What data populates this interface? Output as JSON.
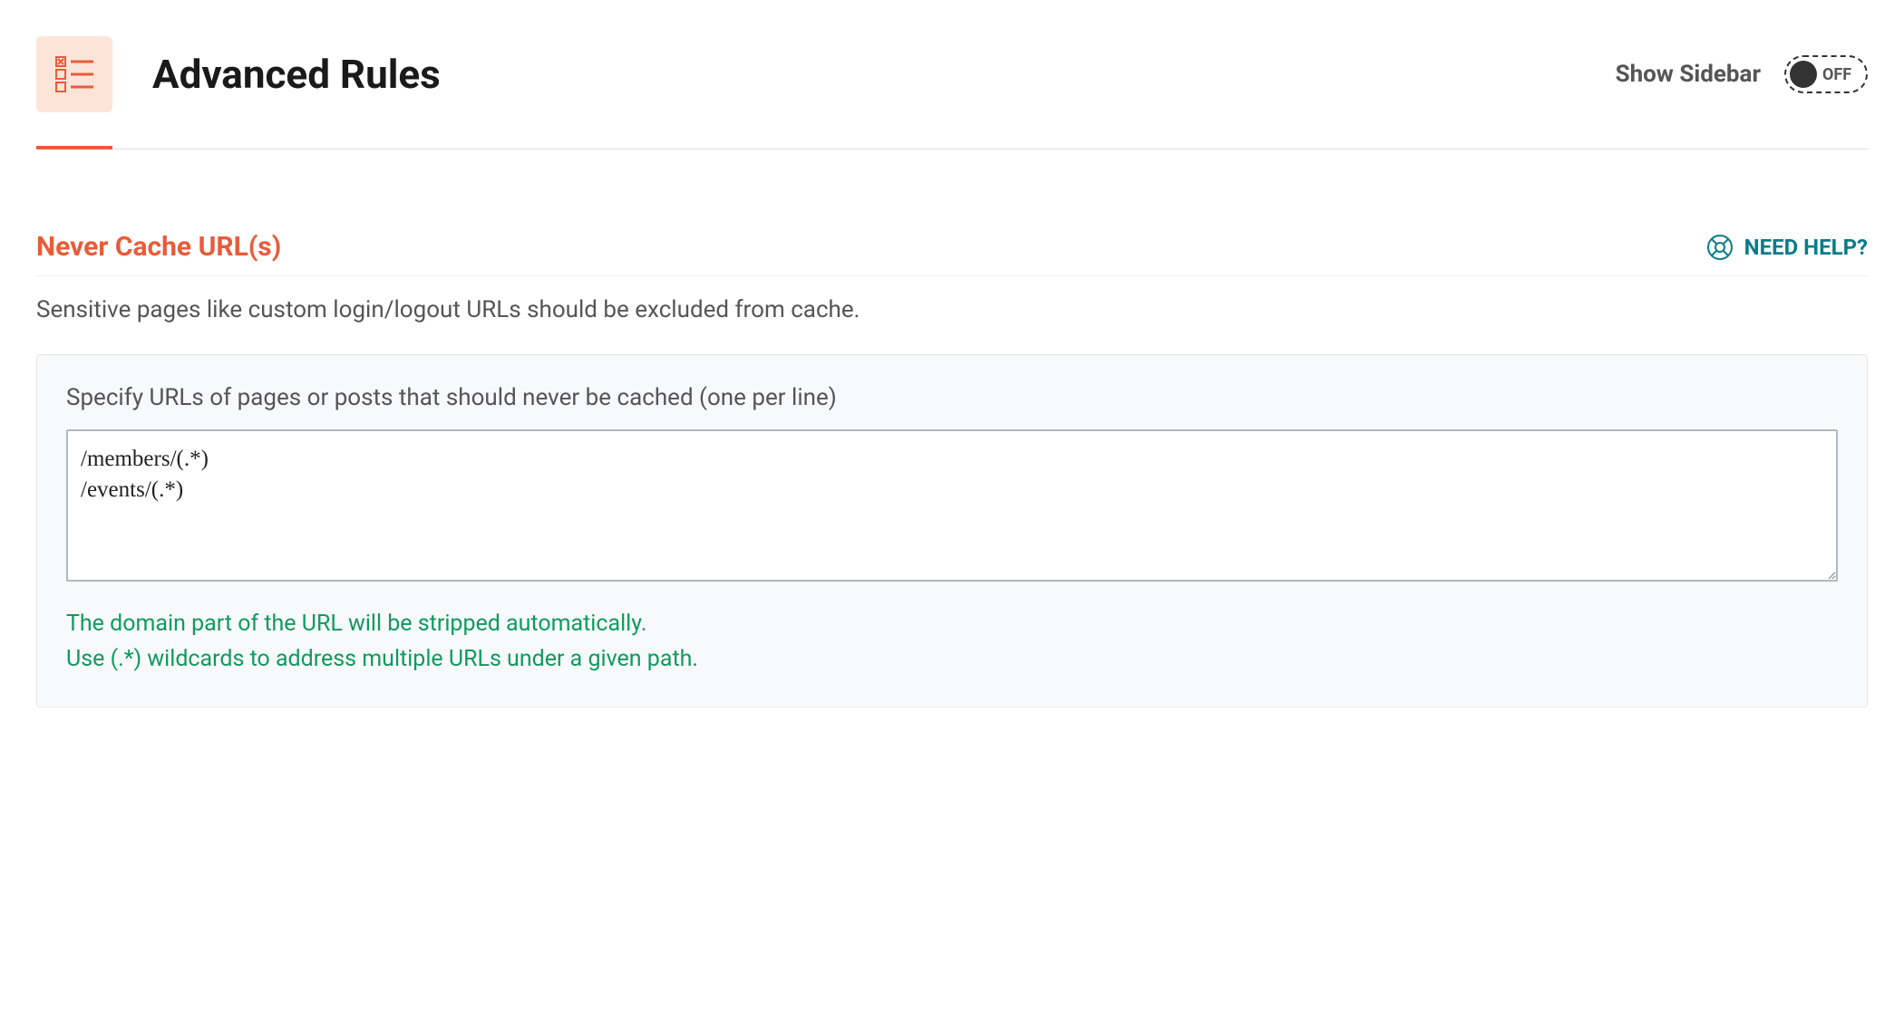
{
  "header": {
    "title": "Advanced Rules",
    "sidebar_toggle_label": "Show Sidebar",
    "sidebar_toggle_state": "OFF"
  },
  "section": {
    "title": "Never Cache URL(s)",
    "help_label": "NEED HELP?",
    "description": "Sensitive pages like custom login/logout URLs should be excluded from cache."
  },
  "field": {
    "label": "Specify URLs of pages or posts that should never be cached (one per line)",
    "value": "/members/(.*)\n/events/(.*)",
    "hint_line1": "The domain part of the URL will be stripped automatically.",
    "hint_line2": "Use (.*) wildcards to address multiple URLs under a given path."
  }
}
